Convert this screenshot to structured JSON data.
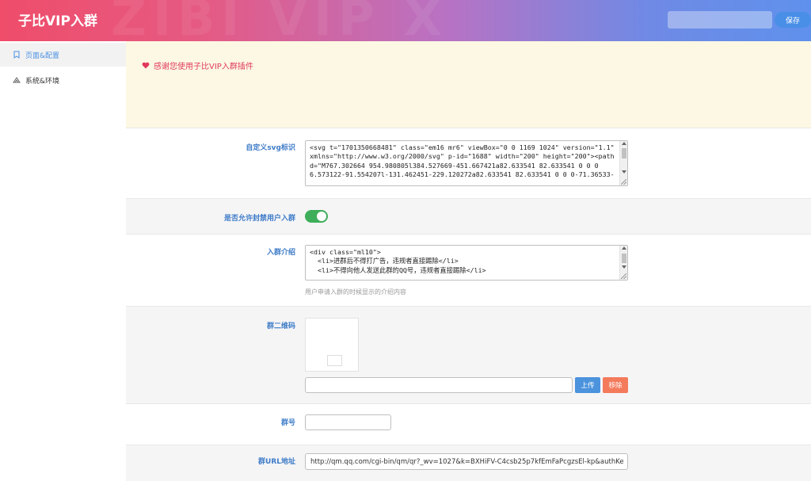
{
  "header": {
    "title": "子比VIP入群",
    "save_label": "保存",
    "watermark": "ZIBI VIP X"
  },
  "sidebar": {
    "items": [
      {
        "label": "页面&配置",
        "icon": "bookmark-icon",
        "active": true
      },
      {
        "label": "系统&环境",
        "icon": "settings-icon",
        "active": false
      }
    ]
  },
  "notice": {
    "text": "感谢您使用子比VIP入群插件",
    "icon": "heart-icon",
    "color": "#e0395c"
  },
  "fields": {
    "svg": {
      "label": "自定义svg标识",
      "lines": [
        "<svg t=\"1701350668481\" class=\"em16 mr6\" viewBox=\"0 0 1169 1024\" version=\"1.1\"",
        "xmlns=\"http://www.w3.org/2000/svg\" p-id=\"1688\" width=\"200\" height=\"200\"><path",
        "d=\"M767.302664 954.980805l384.527669-451.667421a82.633541 82.633541 0 0 0",
        "6.573122-91.554207l-131.462451-229.120272a82.633541 82.633541 0 0 0-71.36533-"
      ]
    },
    "allow_banned": {
      "label": "是否允许封禁用户入群",
      "enabled": true,
      "color": "#3fae5a"
    },
    "intro": {
      "label": "入群介绍",
      "lines": [
        "<div class=\"ml10\">",
        "  <li>进群后不得打广告，违规者直接踢除</li>",
        "  <li>不得向他人发送此群的QQ号，违规者直接踢除</li>"
      ],
      "hint": "用户申请入群的时候显示的介绍内容"
    },
    "qrcode": {
      "label": "群二维码",
      "url_value": "",
      "upload_label": "上传",
      "remove_label": "移除"
    },
    "group_number": {
      "label": "群号",
      "value": ""
    },
    "group_url": {
      "label": "群URL地址",
      "value": "http://qm.qq.com/cgi-bin/qm/qr?_wv=1027&k=BXHiFV-C4csb25p7kfEmFaPcgzsEl-kp&authKe"
    }
  }
}
